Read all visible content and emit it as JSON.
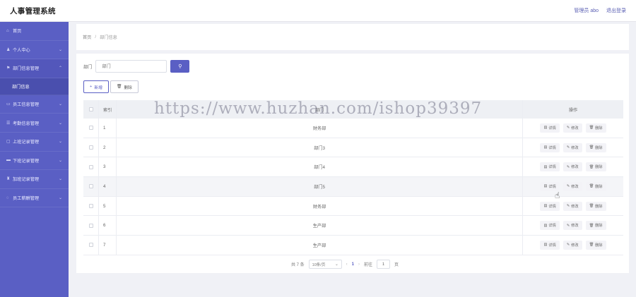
{
  "app": {
    "title": "人事管理系统",
    "user_label": "管理员 abo",
    "logout_label": "退出登录"
  },
  "sidebar": {
    "items": [
      {
        "icon": "⌂",
        "label": "首页",
        "arrow": ""
      },
      {
        "icon": "♟",
        "label": "个人中心",
        "arrow": "⌄"
      },
      {
        "icon": "⚑",
        "label": "部门信息管理",
        "arrow": "⌃",
        "sub": "部门信息"
      },
      {
        "icon": "▭",
        "label": "员工信息管理",
        "arrow": "⌄"
      },
      {
        "icon": "☰",
        "label": "考勤信息管理",
        "arrow": "⌄"
      },
      {
        "icon": "▢",
        "label": "上班记录管理",
        "arrow": "⌄"
      },
      {
        "icon": "▬",
        "label": "下班记录管理",
        "arrow": "⌄"
      },
      {
        "icon": "♜",
        "label": "加班记录管理",
        "arrow": "⌄"
      },
      {
        "icon": "◌",
        "label": "员工薪酬管理",
        "arrow": "⌄"
      }
    ]
  },
  "breadcrumb": {
    "home": "首页",
    "separator": "/",
    "current": "部门信息"
  },
  "search": {
    "label": "部门",
    "placeholder": "部门",
    "button_icon": "⚲"
  },
  "toolbar": {
    "add_label": "新增",
    "add_icon": "+",
    "delete_label": "删除",
    "delete_icon": "🗑"
  },
  "table": {
    "headers": {
      "index": "索引",
      "name": "部门",
      "ops": "操作"
    },
    "ops": {
      "detail": "详情",
      "edit": "修改",
      "delete": "删除",
      "detail_icon": "▤",
      "edit_icon": "✎",
      "delete_icon": "🗑"
    },
    "rows": [
      {
        "index": "1",
        "name": "财务部"
      },
      {
        "index": "2",
        "name": "部门3"
      },
      {
        "index": "3",
        "name": "部门4"
      },
      {
        "index": "4",
        "name": "部门5"
      },
      {
        "index": "5",
        "name": "财务部"
      },
      {
        "index": "6",
        "name": "生产部"
      },
      {
        "index": "7",
        "name": "生产部"
      }
    ]
  },
  "pagination": {
    "total": "共 7 条",
    "page_size": "10条/页",
    "prev": "‹",
    "page": "1",
    "next": "›",
    "goto": "前往",
    "page_value": "1",
    "page_unit": "页"
  },
  "watermark": "https://www.huzhan.com/ishop39397",
  "colors": {
    "accent": "#5a5fc4",
    "sidebar": "#5a5fc4"
  }
}
